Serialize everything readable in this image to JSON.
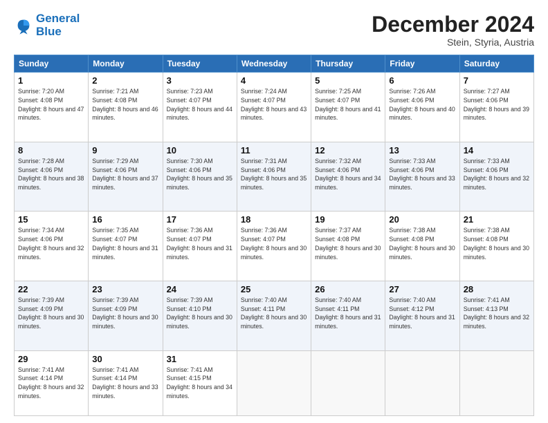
{
  "header": {
    "logo_line1": "General",
    "logo_line2": "Blue",
    "month": "December 2024",
    "location": "Stein, Styria, Austria"
  },
  "weekdays": [
    "Sunday",
    "Monday",
    "Tuesday",
    "Wednesday",
    "Thursday",
    "Friday",
    "Saturday"
  ],
  "weeks": [
    [
      {
        "day": "1",
        "rise": "7:20 AM",
        "set": "4:08 PM",
        "daylight": "8 hours and 47 minutes."
      },
      {
        "day": "2",
        "rise": "7:21 AM",
        "set": "4:08 PM",
        "daylight": "8 hours and 46 minutes."
      },
      {
        "day": "3",
        "rise": "7:23 AM",
        "set": "4:07 PM",
        "daylight": "8 hours and 44 minutes."
      },
      {
        "day": "4",
        "rise": "7:24 AM",
        "set": "4:07 PM",
        "daylight": "8 hours and 43 minutes."
      },
      {
        "day": "5",
        "rise": "7:25 AM",
        "set": "4:07 PM",
        "daylight": "8 hours and 41 minutes."
      },
      {
        "day": "6",
        "rise": "7:26 AM",
        "set": "4:06 PM",
        "daylight": "8 hours and 40 minutes."
      },
      {
        "day": "7",
        "rise": "7:27 AM",
        "set": "4:06 PM",
        "daylight": "8 hours and 39 minutes."
      }
    ],
    [
      {
        "day": "8",
        "rise": "7:28 AM",
        "set": "4:06 PM",
        "daylight": "8 hours and 38 minutes."
      },
      {
        "day": "9",
        "rise": "7:29 AM",
        "set": "4:06 PM",
        "daylight": "8 hours and 37 minutes."
      },
      {
        "day": "10",
        "rise": "7:30 AM",
        "set": "4:06 PM",
        "daylight": "8 hours and 35 minutes."
      },
      {
        "day": "11",
        "rise": "7:31 AM",
        "set": "4:06 PM",
        "daylight": "8 hours and 35 minutes."
      },
      {
        "day": "12",
        "rise": "7:32 AM",
        "set": "4:06 PM",
        "daylight": "8 hours and 34 minutes."
      },
      {
        "day": "13",
        "rise": "7:33 AM",
        "set": "4:06 PM",
        "daylight": "8 hours and 33 minutes."
      },
      {
        "day": "14",
        "rise": "7:33 AM",
        "set": "4:06 PM",
        "daylight": "8 hours and 32 minutes."
      }
    ],
    [
      {
        "day": "15",
        "rise": "7:34 AM",
        "set": "4:06 PM",
        "daylight": "8 hours and 32 minutes."
      },
      {
        "day": "16",
        "rise": "7:35 AM",
        "set": "4:07 PM",
        "daylight": "8 hours and 31 minutes."
      },
      {
        "day": "17",
        "rise": "7:36 AM",
        "set": "4:07 PM",
        "daylight": "8 hours and 31 minutes."
      },
      {
        "day": "18",
        "rise": "7:36 AM",
        "set": "4:07 PM",
        "daylight": "8 hours and 30 minutes."
      },
      {
        "day": "19",
        "rise": "7:37 AM",
        "set": "4:08 PM",
        "daylight": "8 hours and 30 minutes."
      },
      {
        "day": "20",
        "rise": "7:38 AM",
        "set": "4:08 PM",
        "daylight": "8 hours and 30 minutes."
      },
      {
        "day": "21",
        "rise": "7:38 AM",
        "set": "4:08 PM",
        "daylight": "8 hours and 30 minutes."
      }
    ],
    [
      {
        "day": "22",
        "rise": "7:39 AM",
        "set": "4:09 PM",
        "daylight": "8 hours and 30 minutes."
      },
      {
        "day": "23",
        "rise": "7:39 AM",
        "set": "4:09 PM",
        "daylight": "8 hours and 30 minutes."
      },
      {
        "day": "24",
        "rise": "7:39 AM",
        "set": "4:10 PM",
        "daylight": "8 hours and 30 minutes."
      },
      {
        "day": "25",
        "rise": "7:40 AM",
        "set": "4:11 PM",
        "daylight": "8 hours and 30 minutes."
      },
      {
        "day": "26",
        "rise": "7:40 AM",
        "set": "4:11 PM",
        "daylight": "8 hours and 31 minutes."
      },
      {
        "day": "27",
        "rise": "7:40 AM",
        "set": "4:12 PM",
        "daylight": "8 hours and 31 minutes."
      },
      {
        "day": "28",
        "rise": "7:41 AM",
        "set": "4:13 PM",
        "daylight": "8 hours and 32 minutes."
      }
    ],
    [
      {
        "day": "29",
        "rise": "7:41 AM",
        "set": "4:14 PM",
        "daylight": "8 hours and 32 minutes."
      },
      {
        "day": "30",
        "rise": "7:41 AM",
        "set": "4:14 PM",
        "daylight": "8 hours and 33 minutes."
      },
      {
        "day": "31",
        "rise": "7:41 AM",
        "set": "4:15 PM",
        "daylight": "8 hours and 34 minutes."
      },
      null,
      null,
      null,
      null
    ]
  ],
  "labels": {
    "sunrise": "Sunrise:",
    "sunset": "Sunset:",
    "daylight": "Daylight:"
  }
}
